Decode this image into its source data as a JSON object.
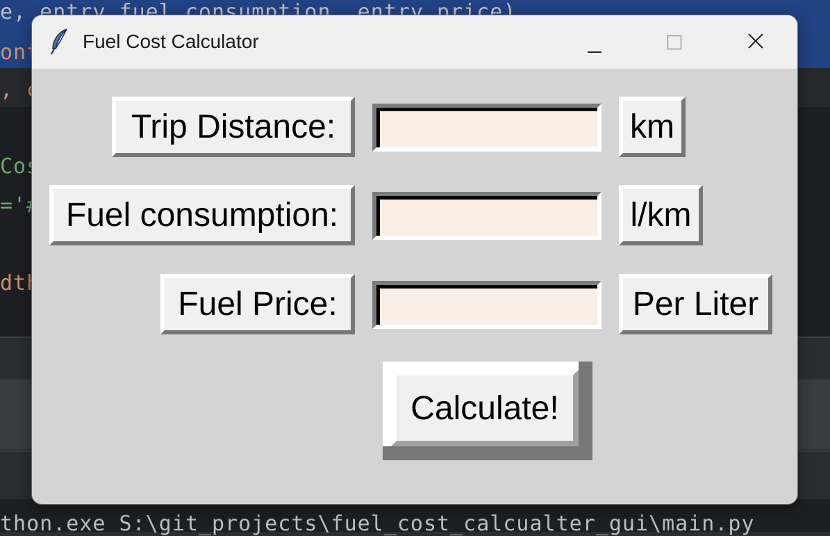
{
  "background": {
    "line1": "e, entry_fuel_consumption, entry_price)",
    "line2": "ont",
    "line3": ", c",
    "line4": "Cos",
    "line5": "='#",
    "line6": "dth",
    "terminal": "thon.exe S:\\git_projects\\fuel_cost_calcualter_gui\\main.py"
  },
  "window": {
    "title": "Fuel Cost Calculator",
    "app_icon": "feather-icon",
    "controls": {
      "minimize_icon": "minimize-icon",
      "maximize_icon": "maximize-icon",
      "close_icon": "close-icon"
    }
  },
  "form": {
    "rows": [
      {
        "label": "Trip Distance:",
        "value": "",
        "unit": "km"
      },
      {
        "label": "Fuel consumption:",
        "value": "",
        "unit": "l/km"
      },
      {
        "label": "Fuel Price:",
        "value": "",
        "unit": "Per Liter"
      }
    ],
    "calculate_label": "Calculate!"
  },
  "colors": {
    "window_bg": "#d4d4d4",
    "titlebar_bg": "#f0f0f0",
    "entry_bg": "#f9efe6",
    "selection_bg": "#214283"
  }
}
